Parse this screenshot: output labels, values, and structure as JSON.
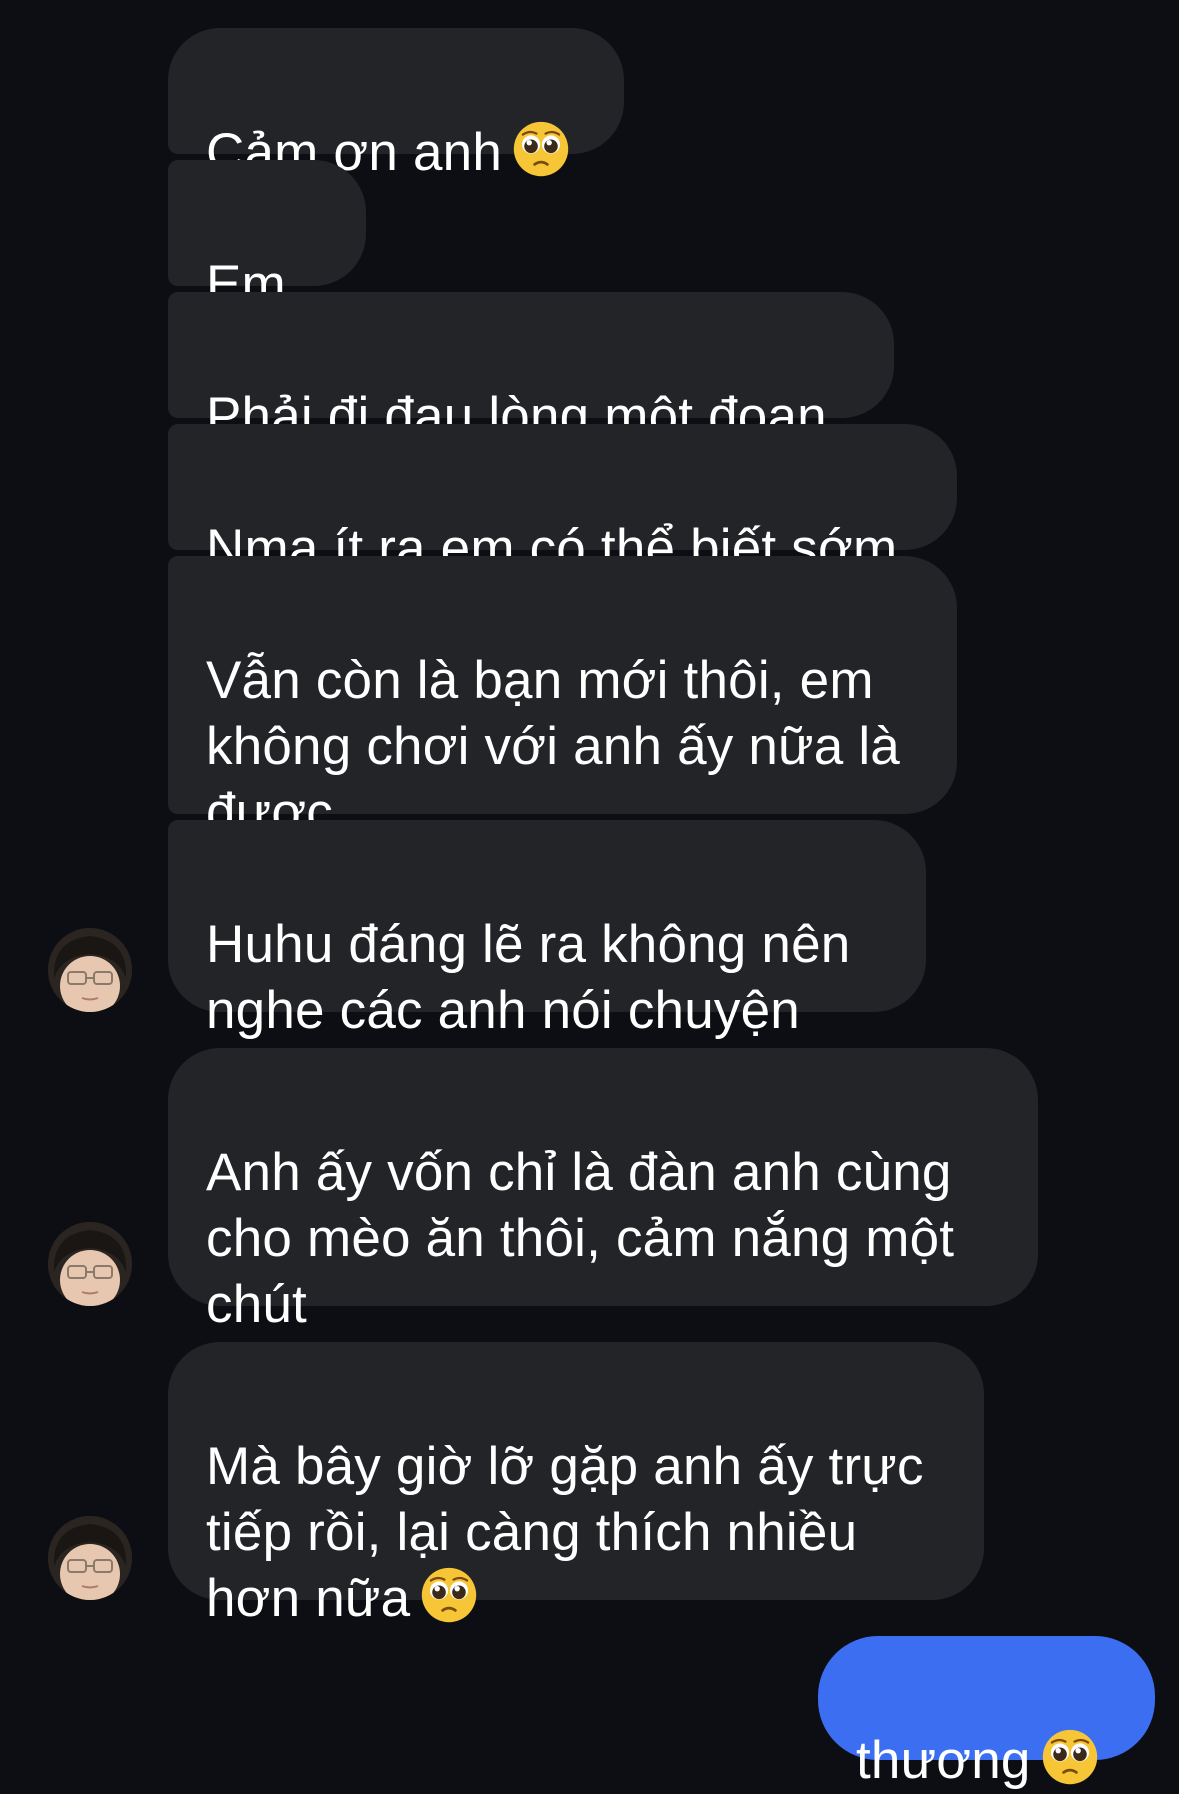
{
  "messages": [
    {
      "text": "Cảm ơn anh",
      "emoji": "pleading-face-icon"
    },
    {
      "text": "Em..."
    },
    {
      "text": "Phải đi đau lòng một đoạn"
    },
    {
      "text": "Nma ít ra em có thể biết sớm"
    },
    {
      "text": "Vẫn còn là bạn mới thôi, em\nkhông chơi với anh ấy nữa là\nđược"
    },
    {
      "text": "Huhu đáng lẽ ra không nên\nnghe các anh nói chuyện"
    },
    {
      "text": "Anh ấy vốn chỉ là đàn anh cùng\ncho mèo ăn thôi, cảm nắng một\nchút"
    },
    {
      "text": "Mà bây giờ lỡ gặp anh ấy trực\ntiếp rồi, lại càng thích nhiều\nhơn nữa",
      "emoji": "pleading-face-icon"
    },
    {
      "text": "thương",
      "emoji": "pleading-face-icon"
    }
  ],
  "colors": {
    "background": "#0d0e13",
    "incoming_bubble": "#232428",
    "outgoing_bubble": "#3b6ef0",
    "text": "#ffffff"
  }
}
